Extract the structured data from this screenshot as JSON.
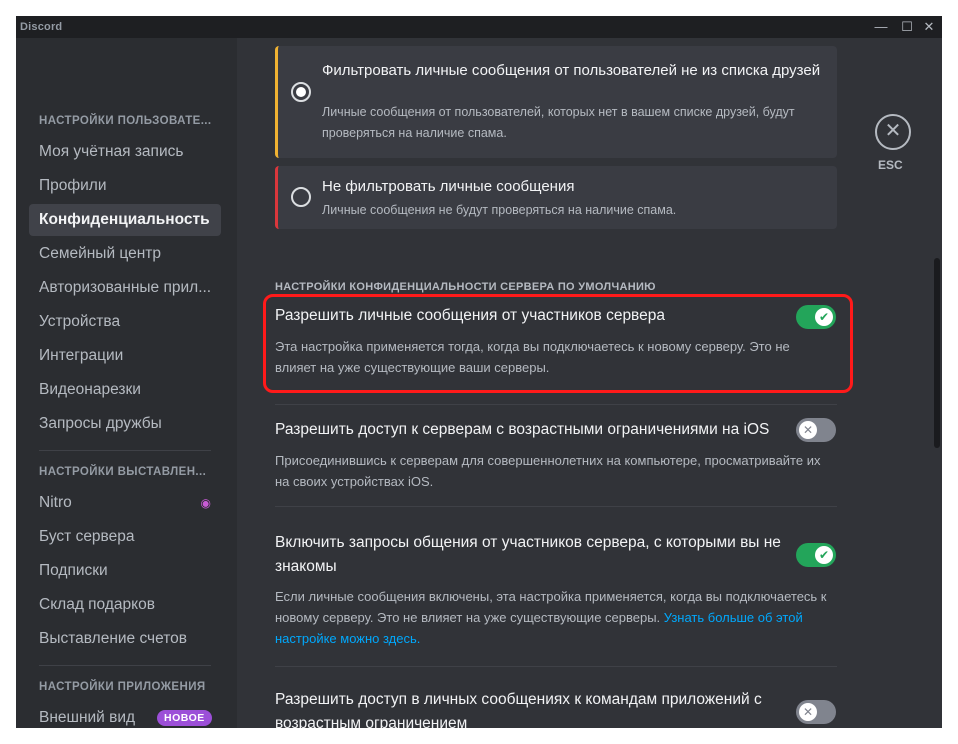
{
  "window": {
    "app_title": "Discord",
    "controls": {
      "minimize": "—",
      "maximize": "☐",
      "close": "✕"
    }
  },
  "sidebar": {
    "sections": [
      {
        "header": "НАСТРОЙКИ ПОЛЬЗОВАТЕ..."
      },
      {
        "header": "НАСТРОЙКИ ВЫСТАВЛЕН..."
      },
      {
        "header": "НАСТРОЙКИ ПРИЛОЖЕНИЯ"
      }
    ],
    "items": [
      {
        "label": "Моя учётная запись"
      },
      {
        "label": "Профили"
      },
      {
        "label": "Конфиденциальность",
        "active": true
      },
      {
        "label": "Семейный центр"
      },
      {
        "label": "Авторизованные прил..."
      },
      {
        "label": "Устройства"
      },
      {
        "label": "Интеграции"
      },
      {
        "label": "Видеонарезки"
      },
      {
        "label": "Запросы дружбы"
      },
      {
        "label": "Nitro",
        "icon": "nitro-icon"
      },
      {
        "label": "Буст сервера"
      },
      {
        "label": "Подписки"
      },
      {
        "label": "Склад подарков"
      },
      {
        "label": "Выставление счетов"
      },
      {
        "label": "Внешний вид",
        "badge": "НОВОЕ"
      }
    ]
  },
  "main": {
    "radio_options": [
      {
        "title": "Фильтровать личные сообщения от пользователей не из списка друзей",
        "description": "Личные сообщения от пользователей, которых нет в вашем списке друзей, будут проверяться на наличие спама.",
        "selected": true
      },
      {
        "title": "Не фильтровать личные сообщения",
        "description": "Личные сообщения не будут проверяться на наличие спама.",
        "selected": false
      }
    ],
    "section_header": "НАСТРОЙКИ КОНФИДЕНЦИАЛЬНОСТИ СЕРВЕРА ПО УМОЛЧАНИЮ",
    "settings": [
      {
        "title": "Разрешить личные сообщения от участников сервера",
        "description": "Эта настройка применяется тогда, когда вы подключаетесь к новому серверу. Это не влияет на уже существующие ваши серверы.",
        "enabled": true
      },
      {
        "title": "Разрешить доступ к серверам с возрастными ограничениями на iOS",
        "description": "Присоединившись к серверам для совершеннолетних на компьютере, просматривайте их на своих устройствах iOS.",
        "enabled": false
      },
      {
        "title": "Включить запросы общения от участников сервера, с которыми вы не знакомы",
        "description": "Если личные сообщения включены, эта настройка применяется, когда вы подключаетесь к новому серверу. Это не влияет на уже существующие серверы.",
        "link": "Узнать больше об этой настройке можно здесь.",
        "enabled": true
      },
      {
        "title": "Разрешить доступ в личных сообщениях к командам приложений с возрастным ограничением",
        "enabled": false
      }
    ],
    "toggle_on_glyph": "✔",
    "toggle_off_glyph": "✕",
    "esc": {
      "glyph": "✕",
      "label": "ESC"
    }
  },
  "colors": {
    "background": "#313338",
    "sidebar": "#2b2d31",
    "titlebar": "#1e1f22",
    "toggle_on": "#23a55a",
    "toggle_off": "#80848e",
    "link": "#00a8fc",
    "highlight": "#ff1a1a",
    "warning_border": "#f0b232",
    "danger_border": "#da373c"
  }
}
